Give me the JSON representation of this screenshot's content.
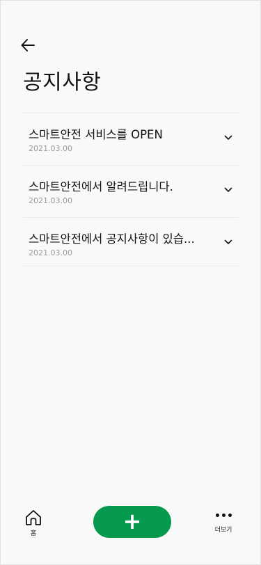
{
  "header": {
    "title": "공지사항",
    "back_icon": "arrow-left-icon"
  },
  "notices": [
    {
      "title": "스마트안전 서비스를 OPEN",
      "date": "2021.03.00"
    },
    {
      "title": "스마트안전에서 알려드립니다.",
      "date": "2021.03.00"
    },
    {
      "title": "스마트안전에서 공지사항이 있습...",
      "date": "2021.03.00"
    }
  ],
  "bottom_nav": {
    "home_label": "홈",
    "home_icon": "home-icon",
    "add_icon": "plus-icon",
    "more_label": "더보기",
    "more_icon": "more-dots-icon"
  },
  "colors": {
    "accent": "#069a4f",
    "background": "#f9f9f9",
    "date_text": "#9a9a9a"
  }
}
